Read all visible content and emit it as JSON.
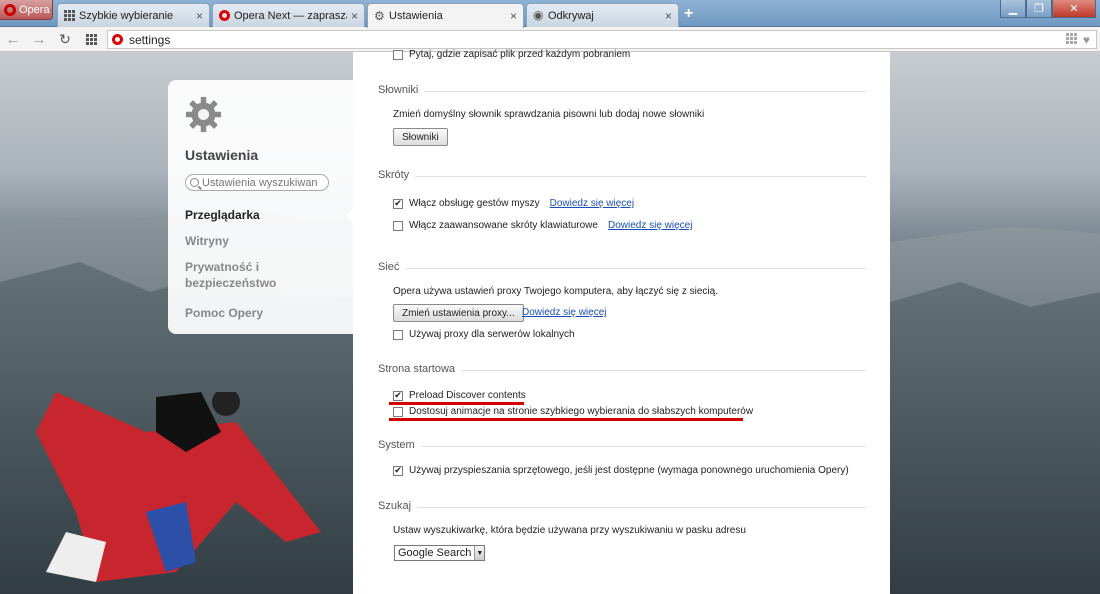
{
  "titlebar": {
    "opera_label": "Opera",
    "tabs": [
      {
        "title": "Szybkie wybieranie",
        "icon": "speed-dial-icon"
      },
      {
        "title": "Opera Next — zapraszamy",
        "icon": "opera-logo-icon"
      },
      {
        "title": "Ustawienia",
        "icon": "gear-icon",
        "active": true
      },
      {
        "title": "Odkrywaj",
        "icon": "eye-icon"
      }
    ],
    "new_tab": "+",
    "close_glyph": "×"
  },
  "toolbar": {
    "url": "settings"
  },
  "sidebar": {
    "title": "Ustawienia",
    "search_placeholder": "Ustawienia wyszukiwan",
    "items": [
      {
        "label": "Przeglądarka",
        "active": true
      },
      {
        "label": "Witryny"
      },
      {
        "label": "Prywatność i bezpieczeństwo"
      },
      {
        "label": "Pomoc Opery"
      }
    ]
  },
  "main": {
    "downloads_partial": "Pytaj, gdzie zapisać plik przed każdym pobraniem",
    "sections": {
      "dictionaries": {
        "title": "Słowniki",
        "description": "Zmień domyślny słownik sprawdzania pisowni lub dodaj nowe słowniki",
        "button": "Słowniki"
      },
      "shortcuts": {
        "title": "Skróty",
        "mouse_gestures": {
          "label": "Włącz obsługę gestów myszy",
          "checked": true,
          "link": "Dowiedz się więcej"
        },
        "keyboard": {
          "label": "Włącz zaawansowane skróty klawiaturowe",
          "checked": false,
          "link": "Dowiedz się więcej"
        }
      },
      "network": {
        "title": "Sieć",
        "description": "Opera używa ustawień proxy Twojego komputera, aby łączyć się z siecią.",
        "button": "Zmień ustawienia proxy...",
        "link": "Dowiedz się więcej",
        "local_proxy": {
          "label": "Używaj proxy dla serwerów lokalnych",
          "checked": false
        }
      },
      "startup": {
        "title": "Strona startowa",
        "preload": {
          "label": "Preload Discover contents",
          "checked": true
        },
        "animation": {
          "label": "Dostosuj animacje na stronie szybkiego wybierania do słabszych komputerów",
          "checked": false
        }
      },
      "system": {
        "title": "System",
        "hw_accel": {
          "label": "Używaj przyspieszania sprzętowego, jeśli jest dostępne (wymaga ponownego uruchomienia Opery)",
          "checked": true
        }
      },
      "search": {
        "title": "Szukaj",
        "description": "Ustaw wyszukiwarkę, która będzie używana przy wyszukiwaniu w pasku adresu",
        "engine": "Google Search"
      }
    }
  },
  "colors": {
    "link": "#1a4fb5",
    "annotation_red": "#d40000",
    "opera_red": "#dd0000"
  }
}
